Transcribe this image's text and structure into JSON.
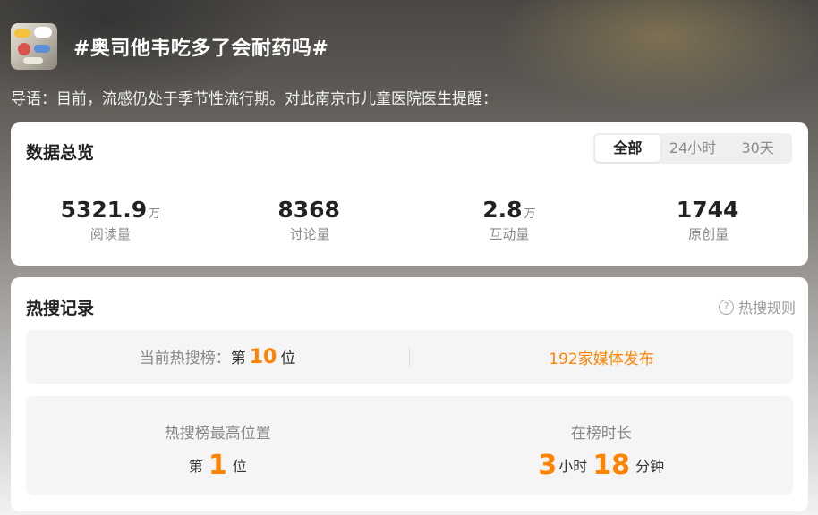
{
  "header": {
    "title": "#奥司他韦吃多了会耐药吗#",
    "lead": "导语：目前，流感仍处于季节性流行期。对此南京市儿童医院医生提醒："
  },
  "overview": {
    "title": "数据总览",
    "tabs": [
      "全部",
      "24小时",
      "30天"
    ],
    "active_tab": "全部",
    "stats": [
      {
        "value": "5321.9",
        "unit": "万",
        "label": "阅读量"
      },
      {
        "value": "8368",
        "unit": "",
        "label": "讨论量"
      },
      {
        "value": "2.8",
        "unit": "万",
        "label": "互动量"
      },
      {
        "value": "1744",
        "unit": "",
        "label": "原创量"
      }
    ]
  },
  "history": {
    "title": "热搜记录",
    "rules_label": "热搜规则",
    "rules_icon": "question-circle-icon",
    "current_rank": {
      "label": "当前热搜榜：",
      "prefix": "第",
      "value": "10",
      "suffix": "位"
    },
    "media": "192家媒体发布",
    "peak": {
      "label": "热搜榜最高位置",
      "prefix": "第",
      "value": "1",
      "suffix": "位"
    },
    "duration": {
      "label": "在榜时长",
      "hours": "3",
      "hours_unit": "小时",
      "minutes": "18",
      "minutes_unit": "分钟"
    }
  },
  "colors": {
    "accent": "#ff8200",
    "card": "#ffffff",
    "panel": "#f5f5f5"
  }
}
